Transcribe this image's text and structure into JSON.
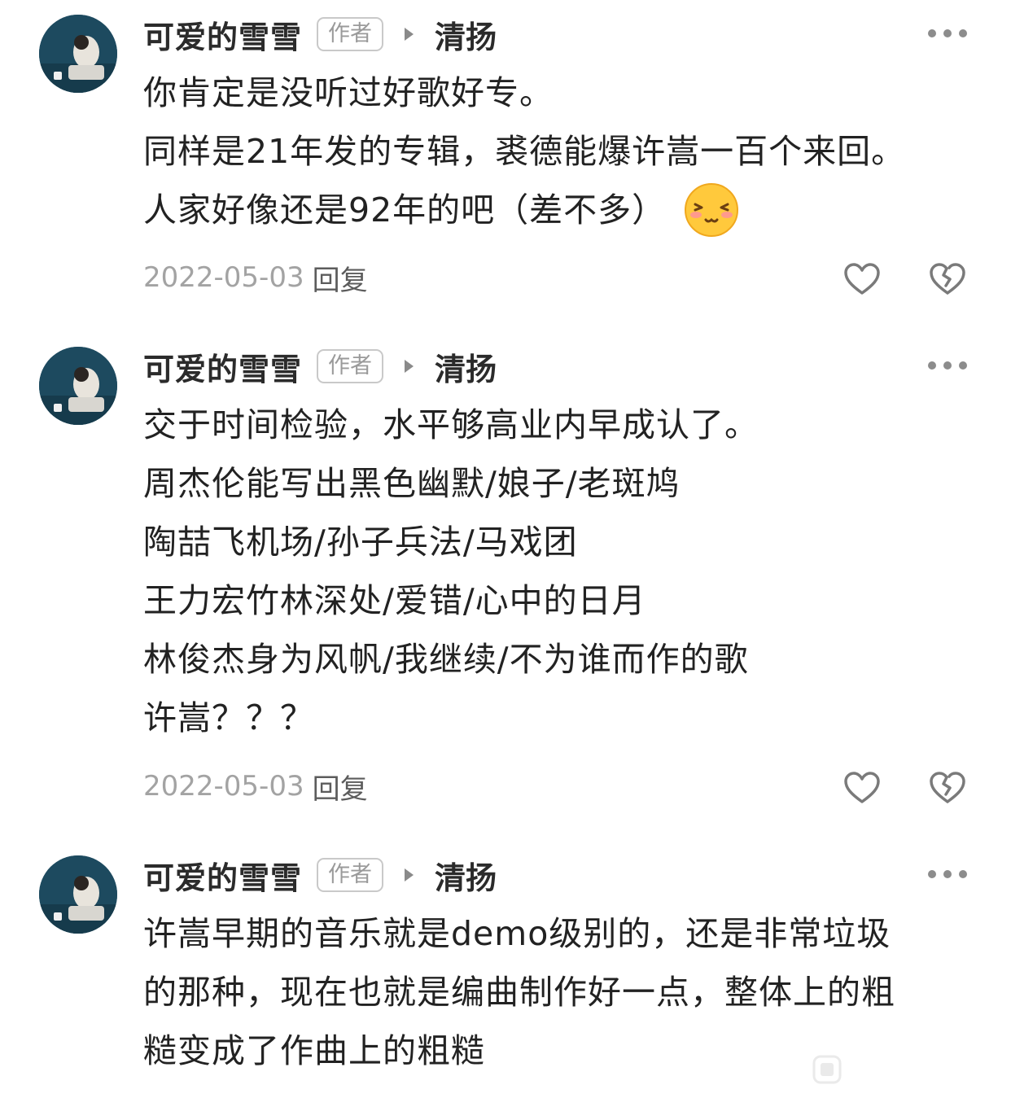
{
  "icons": {
    "avatar": "avatar-image",
    "reply_arrow": "triangle-right-icon",
    "more": "more-dots-icon",
    "like": "heart-outline-icon",
    "dislike": "broken-heart-icon",
    "emoji": "shy-smile-emoji"
  },
  "colors": {
    "badge_border": "#c9c9c9",
    "meta_gray": "#a3a3a3",
    "icon_gray": "#8c8c8c"
  },
  "comments": [
    {
      "username": "可爱的雪雪",
      "badge": "作者",
      "reply_to": "清扬",
      "lines": [
        "你肯定是没听过好歌好专。",
        "同样是21年发的专辑，裘德能爆许嵩一百个来回。",
        "人家好像还是92年的吧（差不多）"
      ],
      "date": "2022-05-03",
      "reply_label": "回复"
    },
    {
      "username": "可爱的雪雪",
      "badge": "作者",
      "reply_to": "清扬",
      "lines": [
        "交于时间检验，水平够高业内早成认了。",
        "周杰伦能写出黑色幽默/娘子/老斑鸠",
        "陶喆飞机场/孙子兵法/马戏团",
        "王力宏竹林深处/爱错/心中的日月",
        "林俊杰身为风帆/我继续/不为谁而作的歌",
        "许嵩？？？"
      ],
      "date": "2022-05-03",
      "reply_label": "回复"
    },
    {
      "username": "可爱的雪雪",
      "badge": "作者",
      "reply_to": "清扬",
      "lines": [
        "许嵩早期的音乐就是demo级别的，还是非常垃圾",
        "的那种，现在也就是编曲制作好一点，整体上的粗",
        "糙变成了作曲上的粗糙"
      ]
    }
  ]
}
